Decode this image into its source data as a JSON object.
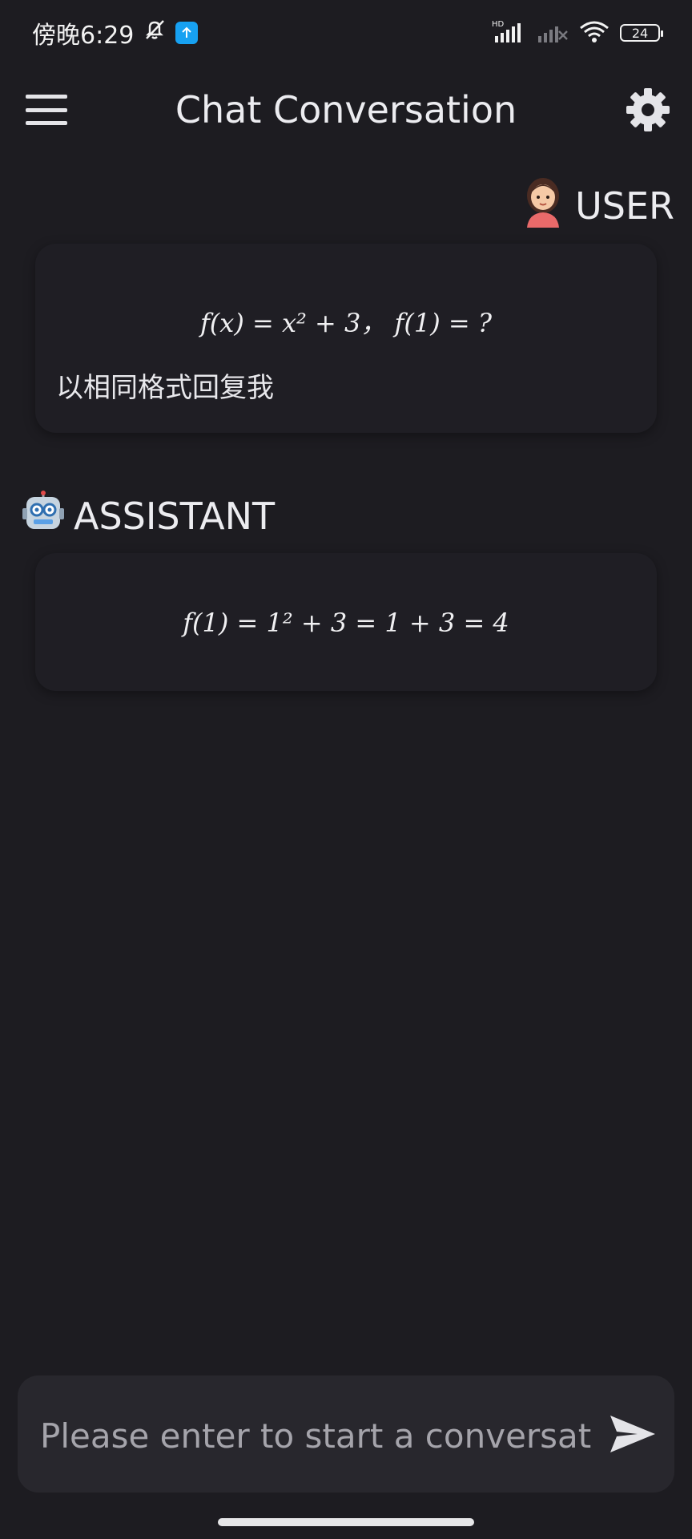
{
  "status_bar": {
    "time": "傍晚6:29",
    "battery": "24",
    "network_label": "HD"
  },
  "app_bar": {
    "title": "Chat Conversation"
  },
  "messages": [
    {
      "role_label": "USER",
      "math": "f(x) = x² + 3， f(1) = ?",
      "text": "以相同格式回复我"
    },
    {
      "role_label": "ASSISTANT",
      "math": "f(1) = 1² + 3 = 1 + 3 = 4"
    }
  ],
  "input": {
    "placeholder": "Please enter to start a conversation",
    "value": ""
  },
  "colors": {
    "background": "#1d1c21",
    "bubble": "#1f1e24",
    "input_bar": "#28272d",
    "text": "#ececf0",
    "upload_badge": "#17a1f2"
  },
  "icons": {
    "menu": "hamburger-menu-icon",
    "settings": "gear-icon",
    "send": "send-icon",
    "user_avatar": "user-avatar-icon",
    "assistant_avatar": "robot-icon"
  }
}
